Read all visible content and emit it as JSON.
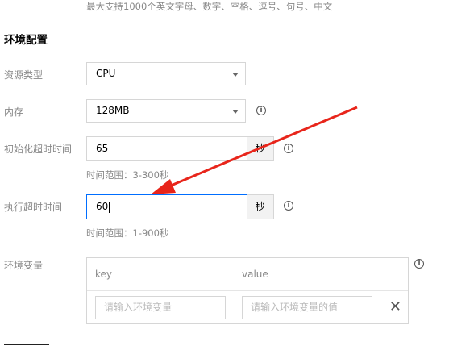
{
  "top_hint": "最大支持1000个英文字母、数字、空格、逗号、句号、中文",
  "section_title": "环境配置",
  "resource_type": {
    "label": "资源类型",
    "value": "CPU"
  },
  "memory": {
    "label": "内存",
    "value": "128MB"
  },
  "init_timeout": {
    "label": "初始化超时时间",
    "value": "65",
    "unit": "秒",
    "range": "时间范围：3-300秒"
  },
  "exec_timeout": {
    "label": "执行超时时间",
    "value": "60",
    "unit": "秒",
    "range": "时间范围：1-900秒"
  },
  "env_vars": {
    "label": "环境变量",
    "col_key": "key",
    "col_value": "value",
    "key_placeholder": "请输入环境变量",
    "value_placeholder": "请输入环境变量的值"
  },
  "icons": {
    "info": "info-circle-icon",
    "caret": "caret-down-icon",
    "remove": "close-icon",
    "arrow": "red-arrow-annotation"
  },
  "colors": {
    "focus": "#006eff",
    "annotation": "#e8251b"
  }
}
